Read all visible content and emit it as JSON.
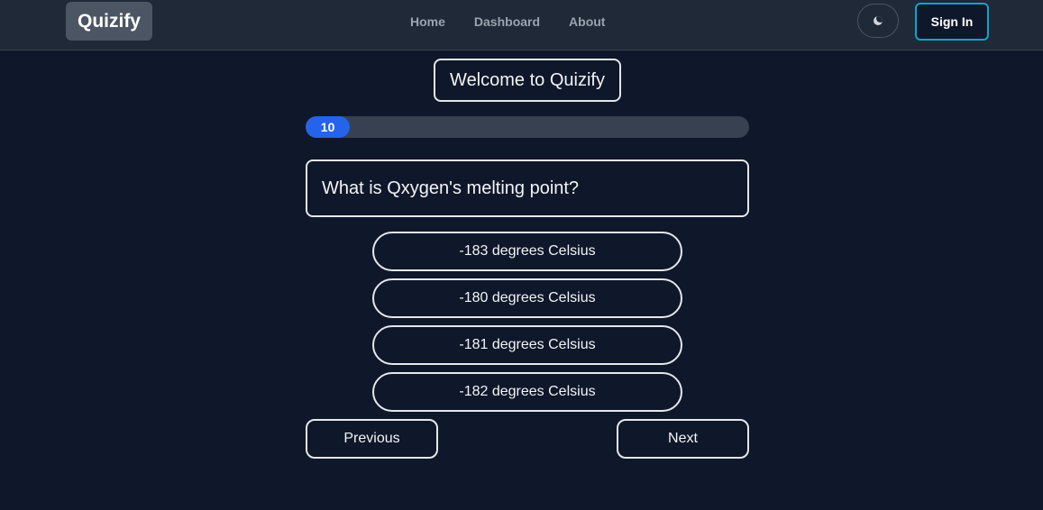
{
  "navbar": {
    "brand": "Quizify",
    "links": [
      "Home",
      "Dashboard",
      "About"
    ],
    "theme_icon": "moon-icon",
    "signin_label": "Sign In"
  },
  "quiz": {
    "welcome": "Welcome to Quizify",
    "progress_label": "10",
    "progress_percent": 10,
    "question": "What is Qxygen's melting point?",
    "answers": [
      "-183 degrees Celsius",
      "-180 degrees Celsius",
      "-181 degrees Celsius",
      "-182 degrees Celsius"
    ],
    "previous_label": "Previous",
    "next_label": "Next"
  },
  "colors": {
    "background": "#0f172a",
    "navbar": "#1f2937",
    "accent": "#2563eb",
    "signin_border": "#0ea5c9"
  }
}
